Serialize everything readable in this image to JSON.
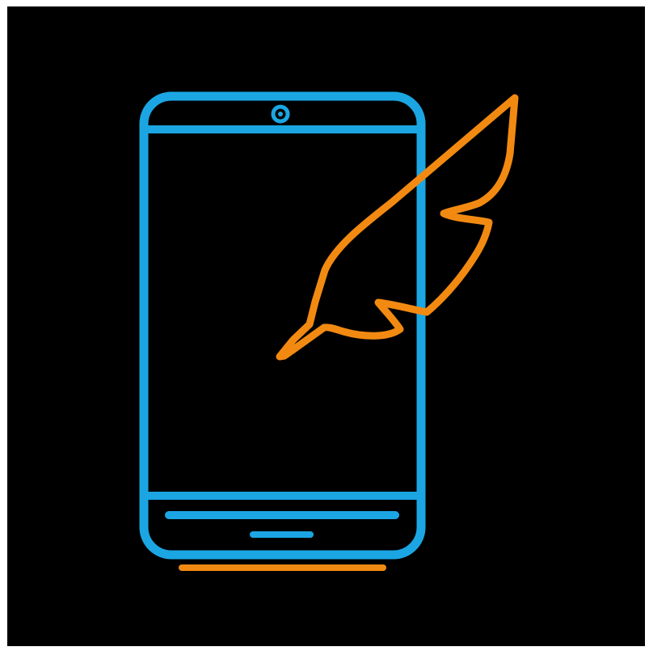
{
  "logo": {
    "icon_name": "phone-with-quill-icon",
    "colors": {
      "background": "#000000",
      "frame": "#ffffff",
      "phone": "#1ba6e3",
      "quill": "#f28a12"
    }
  }
}
